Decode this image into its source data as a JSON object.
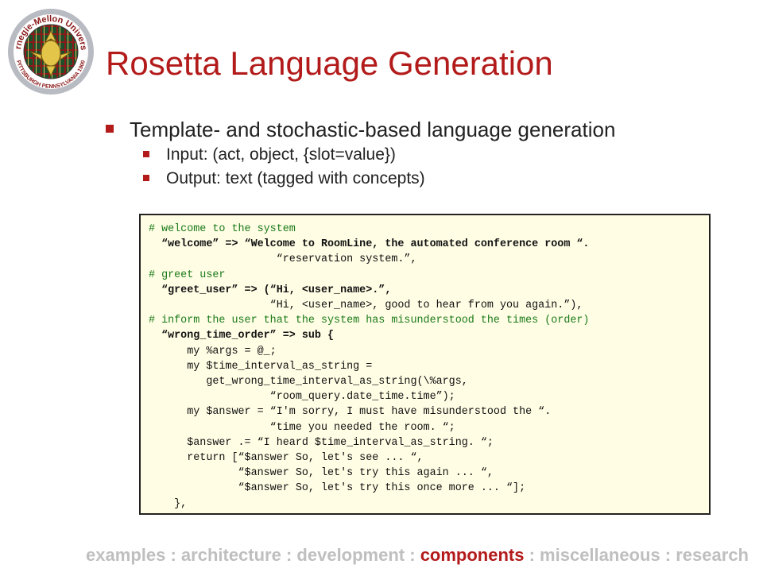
{
  "slide": {
    "title": "Rosetta Language Generation",
    "bullets": [
      {
        "text": "Template- and stochastic-based language generation",
        "level": 1
      },
      {
        "text": "Input: (act, object, {slot=value})",
        "level": 2
      },
      {
        "text": "Output: text (tagged with concepts)",
        "level": 2
      }
    ]
  },
  "logo": {
    "top_text": "Carnegie-Mellon University",
    "bottom_text": "PITTSBURGH PENNSYLVANIA 1900"
  },
  "code": {
    "lines": [
      "# welcome to the system",
      "  “welcome” => “Welcome to RoomLine, the automated conference room “.",
      "                    “reservation system.”,",
      "# greet user",
      "  “greet_user” => (“Hi, <user_name>.”,",
      "                   “Hi, <user_name>, good to hear from you again.”),",
      "# inform the user that the system has misunderstood the times (order)",
      "  “wrong_time_order” => sub {",
      "      my %args = @_;",
      "      my $time_interval_as_string =",
      "         get_wrong_time_interval_as_string(\\%args,",
      "                   “room_query.date_time.time”);",
      "      my $answer = “I'm sorry, I must have misunderstood the “.",
      "                   “time you needed the room. “;",
      "      $answer .= “I heard $time_interval_as_string. “;",
      "      return [“$answer So, let's see ... “,",
      "              “$answer So, let's try this again ... “,",
      "              “$answer So, let's try this once more ... “];",
      "    },"
    ]
  },
  "nav": {
    "items": [
      "examples",
      "architecture",
      "development",
      "components",
      "miscellaneous",
      "research"
    ],
    "separator": " : ",
    "active": "components"
  },
  "colors": {
    "accent": "#b31b1b",
    "code_bg": "#fffde4",
    "comment": "#1a7a1a",
    "nav_inactive": "#bfbfbf"
  }
}
